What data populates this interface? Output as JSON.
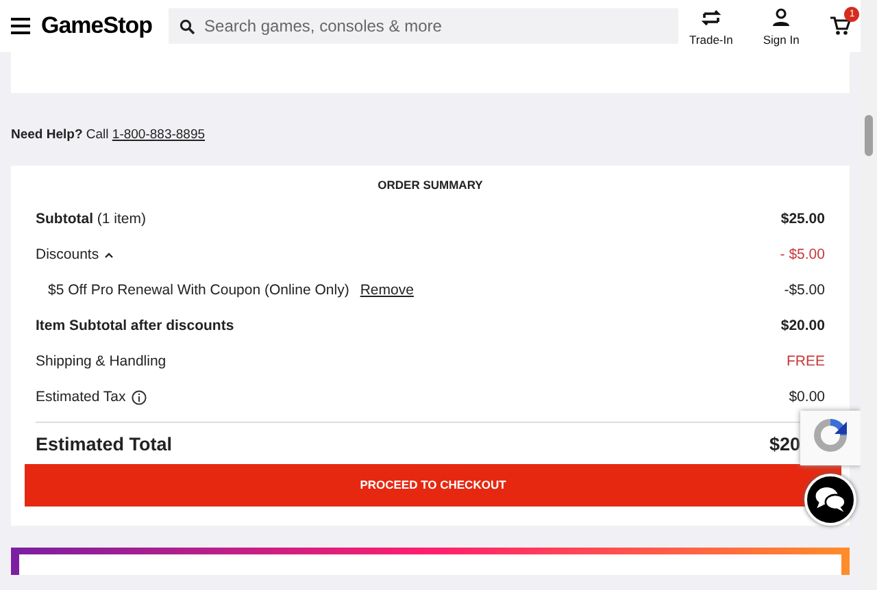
{
  "header": {
    "logo": "GameStop",
    "search": {
      "placeholder": "Search games, consoles & more"
    },
    "actions": [
      {
        "kind": "trade",
        "label": "Trade-In"
      },
      {
        "kind": "account",
        "label": "Sign In"
      },
      {
        "kind": "cart",
        "badge": "1"
      }
    ]
  },
  "help": {
    "lead": "Need Help?",
    "text": "Call",
    "phone": "1-800-883-8895"
  },
  "summary": {
    "title": "ORDER SUMMARY",
    "rows": [
      {
        "kind": "subtotal",
        "label": "**Subtotal** (1 item)",
        "value": "$25.00",
        "emphasis": true,
        "accent": false
      },
      {
        "kind": "toggle",
        "label": "Discounts",
        "expanded": true,
        "value": "- $5.00",
        "emphasis": false,
        "accent": true
      },
      {
        "kind": "coupon",
        "label": "$5 Off Pro Renewal With Coupon (Online Only)",
        "link": "Remove",
        "value": "-$5.00",
        "emphasis": false,
        "accent": false
      },
      {
        "kind": "plain",
        "label": "Item Subtotal after discounts",
        "value": "$20.00",
        "emphasis": true,
        "accent": false
      },
      {
        "kind": "plain",
        "label": "Shipping & Handling",
        "value": "FREE",
        "emphasis": false,
        "accent": true
      },
      {
        "kind": "info",
        "label": "Estimated Tax",
        "value": "$0.00",
        "emphasis": false,
        "accent": false
      }
    ],
    "total": {
      "label": "Estimated Total",
      "value": "$20"
    },
    "checkout": "PROCEED TO CHECKOUT"
  }
}
